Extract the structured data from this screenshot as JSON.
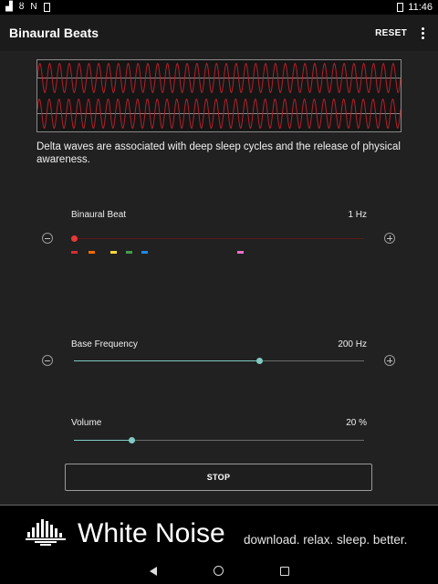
{
  "status_bar": {
    "time": "11:46",
    "icons": [
      "signal-icon",
      "bicycle-icon",
      "notification-icon",
      "sim-icon",
      "battery-icon"
    ]
  },
  "app_bar": {
    "title": "Binaural Beats",
    "reset_label": "RESET",
    "menu_icon": "more-vert-icon"
  },
  "waveform": {
    "channels": 2,
    "wave_color": "#b3202a",
    "frame_color": "#8a8a8a"
  },
  "description": "Delta waves are associated with deep sleep cycles and the release of physical awareness.",
  "binaural_beat": {
    "label": "Binaural Beat",
    "value_text": "1 Hz",
    "level": 0,
    "accent": "#e53935",
    "presets": [
      {
        "name": "delta",
        "color": "#d32f2f"
      },
      {
        "name": "theta",
        "color": "#ef6c00"
      },
      {
        "name": "alpha",
        "color": "#fdd835"
      },
      {
        "name": "beta",
        "color": "#43a047"
      },
      {
        "name": "gamma",
        "color": "#1e88e5"
      },
      {
        "name": "custom",
        "color": "#ec6fc7"
      }
    ]
  },
  "base_frequency": {
    "label": "Base Frequency",
    "value_text": "200 Hz",
    "level": 0.64,
    "accent": "#80cbc4"
  },
  "volume": {
    "label": "Volume",
    "value_text": "20 %",
    "level": 0.2,
    "accent": "#80cbc4"
  },
  "stop_label": "STOP",
  "banner": {
    "brand": "White Noise",
    "tagline": "download. relax. sleep. better."
  },
  "nav_bar": {
    "icons": [
      "back-icon",
      "home-icon",
      "recents-icon"
    ]
  }
}
